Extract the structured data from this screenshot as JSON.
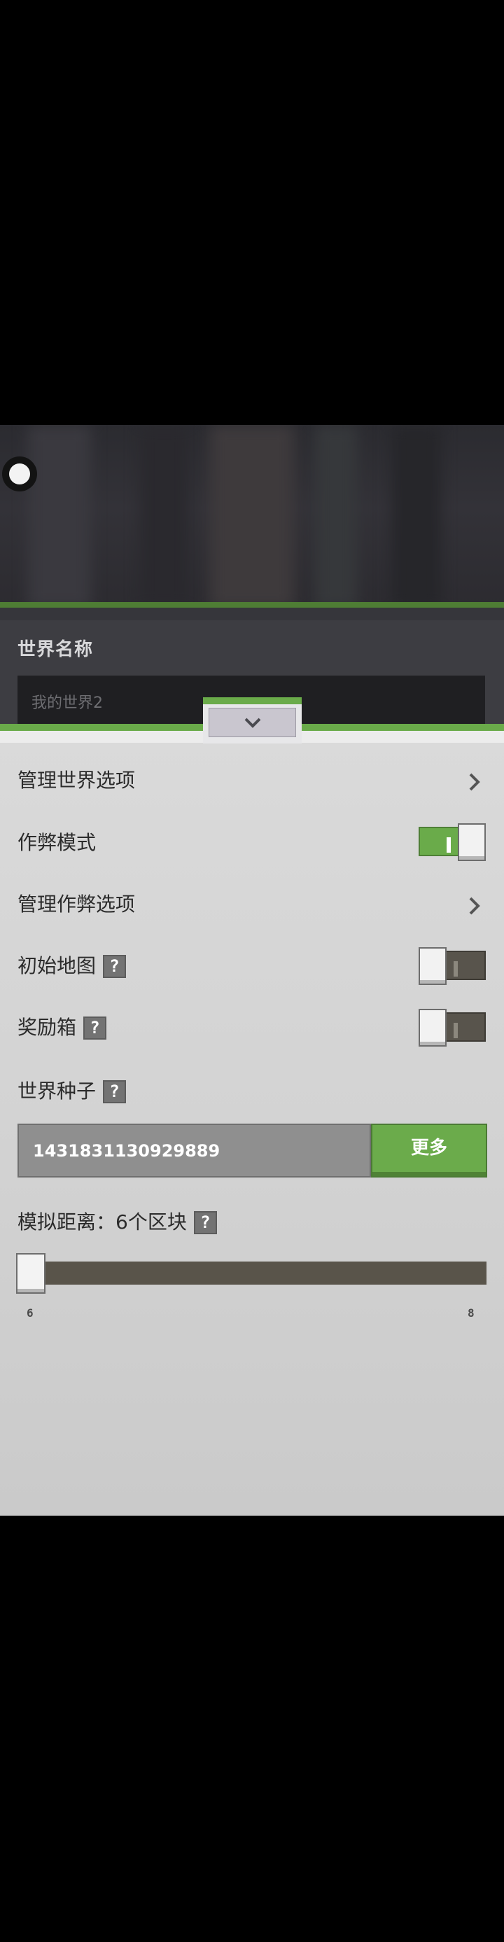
{
  "world": {
    "name_label": "世界名称",
    "name_value": "我的世界2"
  },
  "settings": {
    "manage_world_options": "管理世界选项",
    "cheat_mode": {
      "label": "作弊模式",
      "on": true
    },
    "manage_cheat_options": "管理作弊选项",
    "starter_map": {
      "label": "初始地图",
      "help": "?",
      "on": false
    },
    "bonus_chest": {
      "label": "奖励箱",
      "help": "?",
      "on": false
    },
    "world_seed": {
      "label": "世界种子",
      "help": "?",
      "value": "1431831130929889",
      "more_label": "更多"
    },
    "simulation_distance": {
      "label": "模拟距离：6个区块",
      "help": "?",
      "value": 6,
      "min_label": "6",
      "max_label": "8"
    }
  },
  "colors": {
    "accent_green": "#6aab4a",
    "panel_background": "#d6d6d6",
    "dark_background": "#2e2e33"
  },
  "icons": {
    "back": "circle-icon",
    "collapse": "chevron-down-icon",
    "navigate": "chevron-right-icon",
    "help": "question-icon"
  }
}
